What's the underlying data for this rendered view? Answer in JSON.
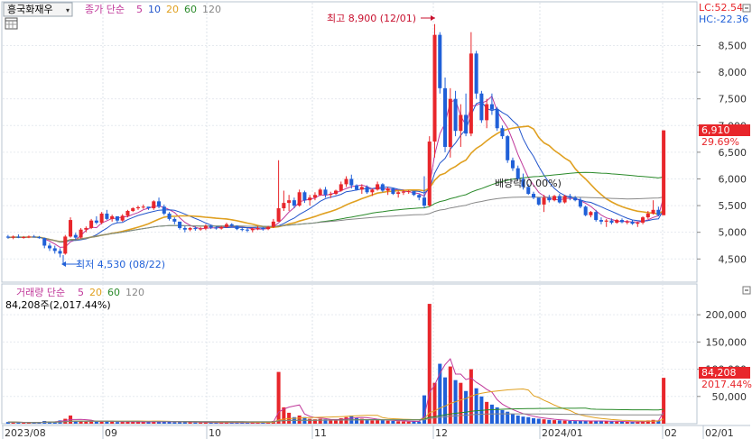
{
  "stock": {
    "name": "흥국화재우",
    "calendar_icon": "calendar-icon",
    "dropdown_icon": "chevron-down-icon"
  },
  "price_legend": [
    {
      "text": "종가 단순",
      "color": "#c0389a"
    },
    {
      "text": "5",
      "color": "#c0389a"
    },
    {
      "text": "10",
      "color": "#2255cc"
    },
    {
      "text": "20",
      "color": "#e0a020"
    },
    {
      "text": "60",
      "color": "#2a8a2a"
    },
    {
      "text": "120",
      "color": "#888888"
    }
  ],
  "volume_legend": [
    {
      "text": "거래량 단순",
      "color": "#c0389a"
    },
    {
      "text": "5",
      "color": "#c0389a"
    },
    {
      "text": "20",
      "color": "#e0a020"
    },
    {
      "text": "60",
      "color": "#2a8a2a"
    },
    {
      "text": "120",
      "color": "#888888"
    }
  ],
  "lc_label": "LC:52.54",
  "hc_label": "HC:-22.36",
  "max_label": "최고 8,900 (12/01)",
  "min_label": "최저 4,530 (08/22)",
  "dividend_label": "배당락(0.00%)",
  "current_price": "6,910",
  "current_change": "29.69%",
  "volume_info": "84,208주(2,017.44%)",
  "current_volume": "84,208",
  "current_volume_change": "2017.44%",
  "colors": {
    "up": "#e8262b",
    "down": "#2060d8",
    "ma5": "#c0389a",
    "ma10": "#2255cc",
    "ma20": "#e0a020",
    "ma60": "#2a8a2a",
    "ma120": "#888888"
  },
  "chart_data": {
    "type": "candlestick",
    "price_axis": {
      "ticks": [
        4500,
        5000,
        5500,
        6000,
        6500,
        7000,
        7500,
        8000,
        8500
      ],
      "labels": [
        "4,500",
        "5,000",
        "5,500",
        "6,000",
        "6,500",
        "7,000",
        "7,500",
        "8,000",
        "8,500"
      ],
      "range": [
        4150,
        9150
      ]
    },
    "volume_axis": {
      "ticks": [
        50000,
        100000,
        150000,
        200000
      ],
      "labels": [
        "50,000",
        "100,000",
        "150,000",
        "200,000"
      ],
      "range": [
        0,
        240000
      ]
    },
    "x_labels": [
      "2023/08",
      "09",
      "10",
      "11",
      "12",
      "2024/01",
      "02",
      "02/01"
    ],
    "candles": [
      [
        4920,
        4950,
        4880,
        4900,
        3000
      ],
      [
        4900,
        4940,
        4870,
        4920,
        2500
      ],
      [
        4920,
        4960,
        4890,
        4900,
        2200
      ],
      [
        4900,
        4930,
        4880,
        4910,
        2000
      ],
      [
        4910,
        4940,
        4890,
        4920,
        2100
      ],
      [
        4920,
        4950,
        4900,
        4910,
        2300
      ],
      [
        4910,
        4930,
        4880,
        4890,
        2500
      ],
      [
        4890,
        4900,
        4700,
        4750,
        5000
      ],
      [
        4750,
        4800,
        4650,
        4700,
        4000
      ],
      [
        4700,
        4750,
        4600,
        4650,
        3800
      ],
      [
        4650,
        4700,
        4530,
        4600,
        6000
      ],
      [
        4600,
        4950,
        4580,
        4920,
        9000
      ],
      [
        4920,
        5280,
        4900,
        5230,
        15000
      ],
      [
        4950,
        4990,
        4860,
        4900,
        4000
      ],
      [
        4900,
        5080,
        4880,
        5050,
        5000
      ],
      [
        5050,
        5110,
        5000,
        5080,
        3500
      ],
      [
        5080,
        5250,
        5060,
        5220,
        4500
      ],
      [
        5220,
        5300,
        5150,
        5180,
        4000
      ],
      [
        5180,
        5380,
        5150,
        5350,
        5000
      ],
      [
        5350,
        5420,
        5230,
        5250,
        4500
      ],
      [
        5250,
        5330,
        5200,
        5300,
        3500
      ],
      [
        5300,
        5280,
        5170,
        5220,
        3000
      ],
      [
        5220,
        5340,
        5200,
        5310,
        3200
      ],
      [
        5310,
        5420,
        5280,
        5400,
        3800
      ],
      [
        5400,
        5470,
        5380,
        5450,
        3500
      ],
      [
        5450,
        5500,
        5420,
        5470,
        3200
      ],
      [
        5470,
        5520,
        5440,
        5480,
        3000
      ],
      [
        5480,
        5450,
        5420,
        5450,
        2800
      ],
      [
        5450,
        5600,
        5420,
        5580,
        4500
      ],
      [
        5580,
        5650,
        5450,
        5480,
        4000
      ],
      [
        5480,
        5520,
        5320,
        5350,
        3800
      ],
      [
        5350,
        5380,
        5220,
        5250,
        3500
      ],
      [
        5250,
        5280,
        5150,
        5200,
        3000
      ],
      [
        5200,
        5120,
        5050,
        5080,
        3200
      ],
      [
        5080,
        5120,
        5000,
        5050,
        2800
      ],
      [
        5050,
        5100,
        5020,
        5080,
        2500
      ],
      [
        5080,
        5110,
        5030,
        5060,
        2300
      ],
      [
        5060,
        5100,
        5030,
        5070,
        2200
      ],
      [
        5070,
        5150,
        5040,
        5120,
        2400
      ],
      [
        5120,
        5130,
        5060,
        5090,
        2100
      ],
      [
        5090,
        5110,
        5050,
        5070,
        2000
      ],
      [
        5070,
        5120,
        5050,
        5100,
        2200
      ],
      [
        5100,
        5180,
        5080,
        5150,
        2300
      ],
      [
        5150,
        5170,
        5100,
        5120,
        2000
      ],
      [
        5120,
        5130,
        5040,
        5060,
        2100
      ],
      [
        5060,
        5090,
        5020,
        5050,
        2000
      ],
      [
        5050,
        5080,
        5000,
        5040,
        1900
      ],
      [
        5040,
        5090,
        5000,
        5070,
        2000
      ],
      [
        5070,
        5120,
        5040,
        5080,
        2100
      ],
      [
        5080,
        5100,
        5030,
        5060,
        2000
      ],
      [
        5060,
        5120,
        5040,
        5100,
        2200
      ],
      [
        5100,
        5250,
        5080,
        5200,
        5000
      ],
      [
        5200,
        6350,
        5200,
        5450,
        95000
      ],
      [
        5450,
        5780,
        5400,
        5550,
        30000
      ],
      [
        5550,
        5700,
        5400,
        5600,
        20000
      ],
      [
        5600,
        5650,
        5450,
        5500,
        12000
      ],
      [
        5500,
        5800,
        5480,
        5750,
        15000
      ],
      [
        5750,
        5780,
        5550,
        5600,
        12000
      ],
      [
        5600,
        5700,
        5500,
        5650,
        9000
      ],
      [
        5650,
        5750,
        5600,
        5700,
        8000
      ],
      [
        5700,
        5830,
        5680,
        5800,
        9000
      ],
      [
        5800,
        5850,
        5650,
        5700,
        8000
      ],
      [
        5700,
        5760,
        5640,
        5720,
        6000
      ],
      [
        5720,
        5800,
        5700,
        5780,
        7000
      ],
      [
        5780,
        5950,
        5760,
        5900,
        10000
      ],
      [
        5900,
        6050,
        5850,
        6000,
        12000
      ],
      [
        6000,
        6080,
        5820,
        5880,
        15000
      ],
      [
        5880,
        5900,
        5780,
        5800,
        11000
      ],
      [
        5800,
        5900,
        5720,
        5850,
        9000
      ],
      [
        5850,
        5880,
        5720,
        5750,
        8000
      ],
      [
        5750,
        5820,
        5680,
        5800,
        6000
      ],
      [
        5800,
        5950,
        5780,
        5900,
        7000
      ],
      [
        5900,
        5920,
        5750,
        5780,
        6500
      ],
      [
        5780,
        5850,
        5700,
        5820,
        5500
      ],
      [
        5820,
        5830,
        5700,
        5720,
        5000
      ],
      [
        5720,
        5780,
        5650,
        5750,
        4500
      ],
      [
        5750,
        5800,
        5700,
        5760,
        4000
      ],
      [
        5760,
        5790,
        5720,
        5770,
        3800
      ],
      [
        5770,
        5750,
        5680,
        5700,
        4200
      ],
      [
        5700,
        5720,
        5600,
        5650,
        4000
      ],
      [
        5650,
        6050,
        5450,
        5500,
        52000
      ],
      [
        5500,
        6800,
        5480,
        6700,
        220000
      ],
      [
        6700,
        8900,
        6400,
        8700,
        75000
      ],
      [
        8700,
        8750,
        7600,
        7700,
        110000
      ],
      [
        7700,
        7900,
        6500,
        6600,
        85000
      ],
      [
        6600,
        7700,
        6400,
        7500,
        105000
      ],
      [
        7500,
        7650,
        6800,
        6900,
        80000
      ],
      [
        6900,
        7400,
        6600,
        7200,
        75000
      ],
      [
        7200,
        7600,
        6800,
        6850,
        60000
      ],
      [
        6850,
        8750,
        6800,
        8350,
        100000
      ],
      [
        8350,
        8400,
        7500,
        7600,
        65000
      ],
      [
        7600,
        7650,
        7050,
        7100,
        50000
      ],
      [
        7100,
        7500,
        6950,
        7400,
        40000
      ],
      [
        7400,
        7600,
        7200,
        7300,
        35000
      ],
      [
        7300,
        7350,
        6900,
        6950,
        30000
      ],
      [
        6950,
        7000,
        6750,
        6800,
        25000
      ],
      [
        6800,
        6820,
        6300,
        6350,
        22000
      ],
      [
        6350,
        6400,
        6150,
        6200,
        18000
      ],
      [
        6200,
        6250,
        5980,
        6000,
        15000
      ],
      [
        6000,
        6100,
        5800,
        5850,
        13000
      ],
      [
        5850,
        5900,
        5700,
        5720,
        12000
      ],
      [
        5720,
        5760,
        5620,
        5650,
        10000
      ],
      [
        5650,
        5620,
        5500,
        5520,
        9000
      ],
      [
        5520,
        5700,
        5380,
        5650,
        8000
      ],
      [
        5650,
        5700,
        5560,
        5600,
        7000
      ],
      [
        5600,
        5700,
        5580,
        5680,
        6500
      ],
      [
        5680,
        5720,
        5540,
        5560,
        6000
      ],
      [
        5560,
        5700,
        5540,
        5680,
        5500
      ],
      [
        5680,
        5720,
        5600,
        5650,
        5000
      ],
      [
        5650,
        5680,
        5580,
        5600,
        4800
      ],
      [
        5600,
        5650,
        5450,
        5480,
        5000
      ],
      [
        5480,
        5500,
        5300,
        5320,
        5500
      ],
      [
        5320,
        5400,
        5280,
        5380,
        4500
      ],
      [
        5380,
        5420,
        5200,
        5230,
        5000
      ],
      [
        5230,
        5280,
        5150,
        5200,
        4800
      ],
      [
        5200,
        5250,
        5100,
        5220,
        4500
      ],
      [
        5220,
        5260,
        5150,
        5180,
        4000
      ],
      [
        5180,
        5250,
        5160,
        5230,
        3800
      ],
      [
        5230,
        5260,
        5170,
        5190,
        3500
      ],
      [
        5190,
        5230,
        5150,
        5200,
        3300
      ],
      [
        5200,
        5230,
        5140,
        5160,
        3000
      ],
      [
        5160,
        5200,
        5100,
        5180,
        3200
      ],
      [
        5180,
        5300,
        5150,
        5280,
        5000
      ],
      [
        5280,
        5400,
        5250,
        5350,
        6000
      ],
      [
        5350,
        5600,
        5330,
        5420,
        7000
      ],
      [
        5420,
        5480,
        5300,
        5320,
        5000
      ],
      [
        5320,
        6910,
        5320,
        6910,
        84208
      ]
    ]
  }
}
